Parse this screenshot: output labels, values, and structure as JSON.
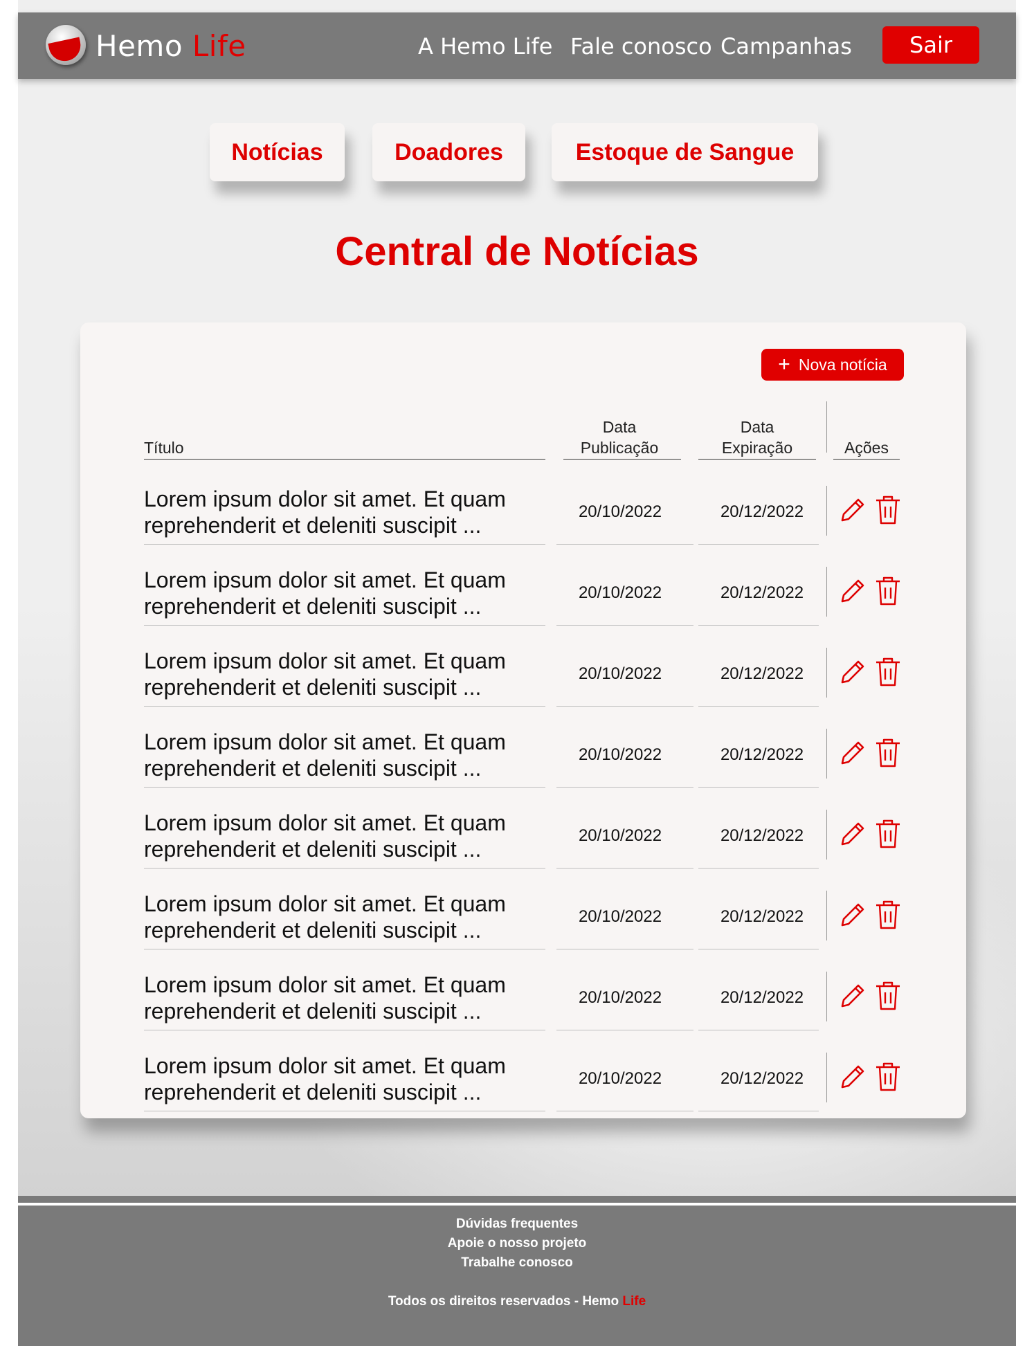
{
  "header": {
    "brand_main": "Hemo",
    "brand_accent": "Life",
    "nav": [
      "A Hemo Life",
      "Fale conosco",
      "Campanhas"
    ],
    "logout": "Sair"
  },
  "tabs": [
    "Notícias",
    "Doadores",
    "Estoque de Sangue"
  ],
  "page_title": "Central de Notícias",
  "news_table": {
    "new_button": "Nova notícia",
    "columns": {
      "title": "Título",
      "pub_line1": "Data",
      "pub_line2": "Publicação",
      "exp_line1": "Data",
      "exp_line2": "Expiração",
      "actions": "Ações"
    },
    "rows": [
      {
        "title1": "Lorem ipsum dolor sit amet. Et quam",
        "title2": "reprehenderit et deleniti suscipit ...",
        "published": "20/10/2022",
        "expires": "20/12/2022"
      },
      {
        "title1": "Lorem ipsum dolor sit amet. Et quam",
        "title2": "reprehenderit et deleniti suscipit ...",
        "published": "20/10/2022",
        "expires": "20/12/2022"
      },
      {
        "title1": "Lorem ipsum dolor sit amet. Et quam",
        "title2": "reprehenderit et deleniti suscipit ...",
        "published": "20/10/2022",
        "expires": "20/12/2022"
      },
      {
        "title1": "Lorem ipsum dolor sit amet. Et quam",
        "title2": "reprehenderit et deleniti suscipit ...",
        "published": "20/10/2022",
        "expires": "20/12/2022"
      },
      {
        "title1": "Lorem ipsum dolor sit amet. Et quam",
        "title2": "reprehenderit et deleniti suscipit ...",
        "published": "20/10/2022",
        "expires": "20/12/2022"
      },
      {
        "title1": "Lorem ipsum dolor sit amet. Et quam",
        "title2": "reprehenderit et deleniti suscipit ...",
        "published": "20/10/2022",
        "expires": "20/12/2022"
      },
      {
        "title1": "Lorem ipsum dolor sit amet. Et quam",
        "title2": "reprehenderit et deleniti suscipit ...",
        "published": "20/10/2022",
        "expires": "20/12/2022"
      },
      {
        "title1": "Lorem ipsum dolor sit amet. Et quam",
        "title2": "reprehenderit et deleniti suscipit ...",
        "published": "20/10/2022",
        "expires": "20/12/2022"
      }
    ],
    "row_icons": [
      "pencil-icon",
      "trash-icon"
    ]
  },
  "footer": {
    "links": [
      "Dúvidas frequentes",
      "Apoie o nosso projeto",
      "Trabalhe conosco"
    ],
    "copyright_prefix": "Todos os direitos reservados - Hemo",
    "copyright_accent": "Life"
  },
  "colors": {
    "accent": "#e00000",
    "header_bg": "#7a7a7a",
    "card_bg": "#f8f5f4",
    "page_bg": "#efefef"
  }
}
